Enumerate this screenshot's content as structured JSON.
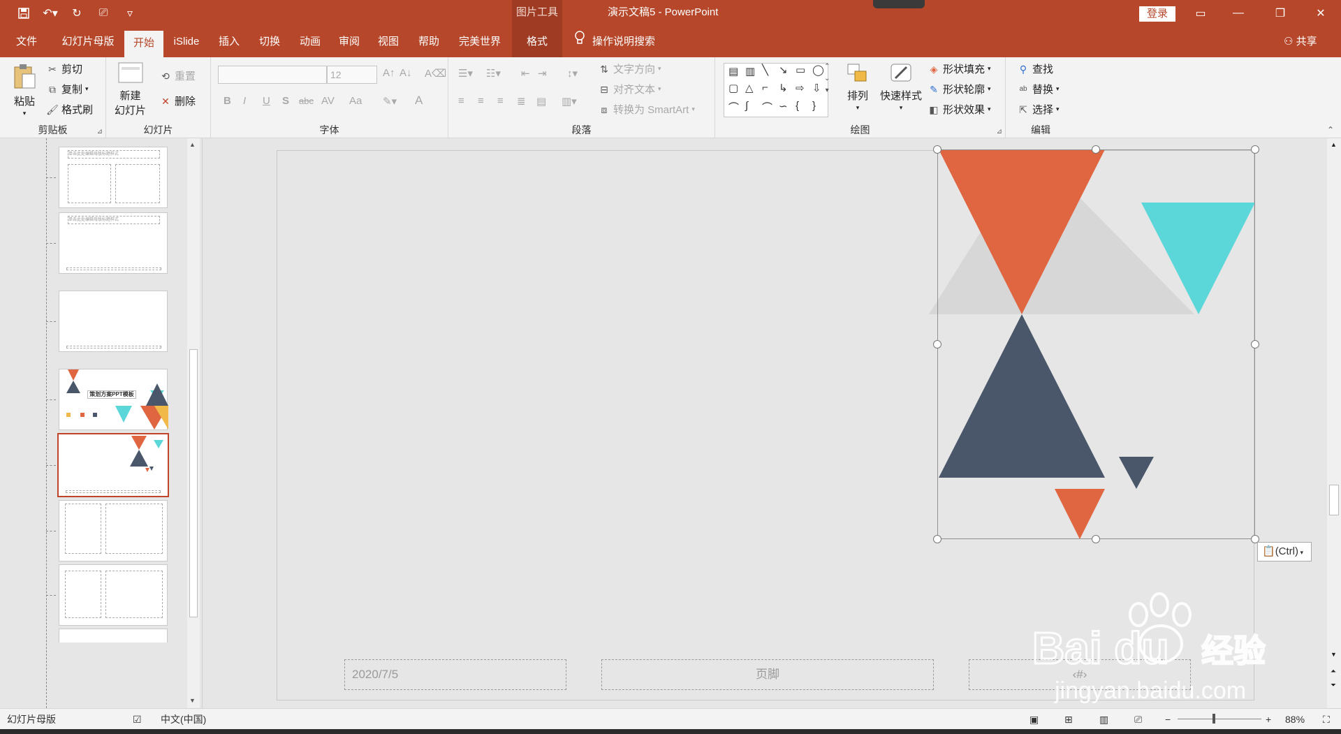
{
  "titlebar": {
    "tools_label": "图片工具",
    "doc_title": "演示文稿5  -  PowerPoint",
    "login": "登录",
    "qat_icons": [
      "save-icon",
      "undo-icon",
      "redo-icon",
      "present-icon",
      "customize-icon"
    ]
  },
  "tabs": [
    "文件",
    "幻灯片母版",
    "开始",
    "iSlide",
    "插入",
    "切换",
    "动画",
    "审阅",
    "视图",
    "帮助",
    "完美世界",
    "格式"
  ],
  "active_tab": "开始",
  "tell_me": "操作说明搜索",
  "share": "共享",
  "ribbon": {
    "clipboard": {
      "label": "剪贴板",
      "paste": "粘贴",
      "cut": "剪切",
      "copy": "复制",
      "format_painter": "格式刷"
    },
    "slides": {
      "label": "幻灯片",
      "new_slide_1": "新建",
      "new_slide_2": "幻灯片",
      "reset": "重置",
      "delete": "删除"
    },
    "font": {
      "label": "字体",
      "font_name": "",
      "font_size": "12",
      "bold": "B",
      "italic": "I",
      "underline": "U",
      "shadow": "S",
      "strike": "abc",
      "spacing": "AV",
      "case": "Aa",
      "color": "A"
    },
    "paragraph": {
      "label": "段落",
      "text_direction": "文字方向",
      "align_text": "对齐文本",
      "smartart": "转换为 SmartArt"
    },
    "drawing": {
      "label": "绘图",
      "arrange": "排列",
      "quick_styles": "快速样式",
      "fill": "形状填充",
      "outline": "形状轮廓",
      "effects": "形状效果"
    },
    "editing": {
      "label": "编辑",
      "find": "查找",
      "replace": "替换",
      "select": "选择"
    }
  },
  "slide": {
    "date": "2020/7/5",
    "footer": "页脚",
    "page_num": "‹#›"
  },
  "thumb_title_text": "单击此处编辑母版标题样式",
  "thumb4_title": "策划方案PPT模板",
  "paste_options": "(Ctrl)",
  "statusbar": {
    "view": "幻灯片母版",
    "language": "中文(中国)",
    "zoom": "88%"
  },
  "colors": {
    "accent": "#b7472a",
    "orange": "#e06641",
    "teal": "#5bd7da",
    "navy": "#4a5669",
    "light_gray": "#d7d7d7"
  },
  "watermark": {
    "brand": "Bai du",
    "cn": "经验",
    "url": "jingyan.baidu.com"
  }
}
